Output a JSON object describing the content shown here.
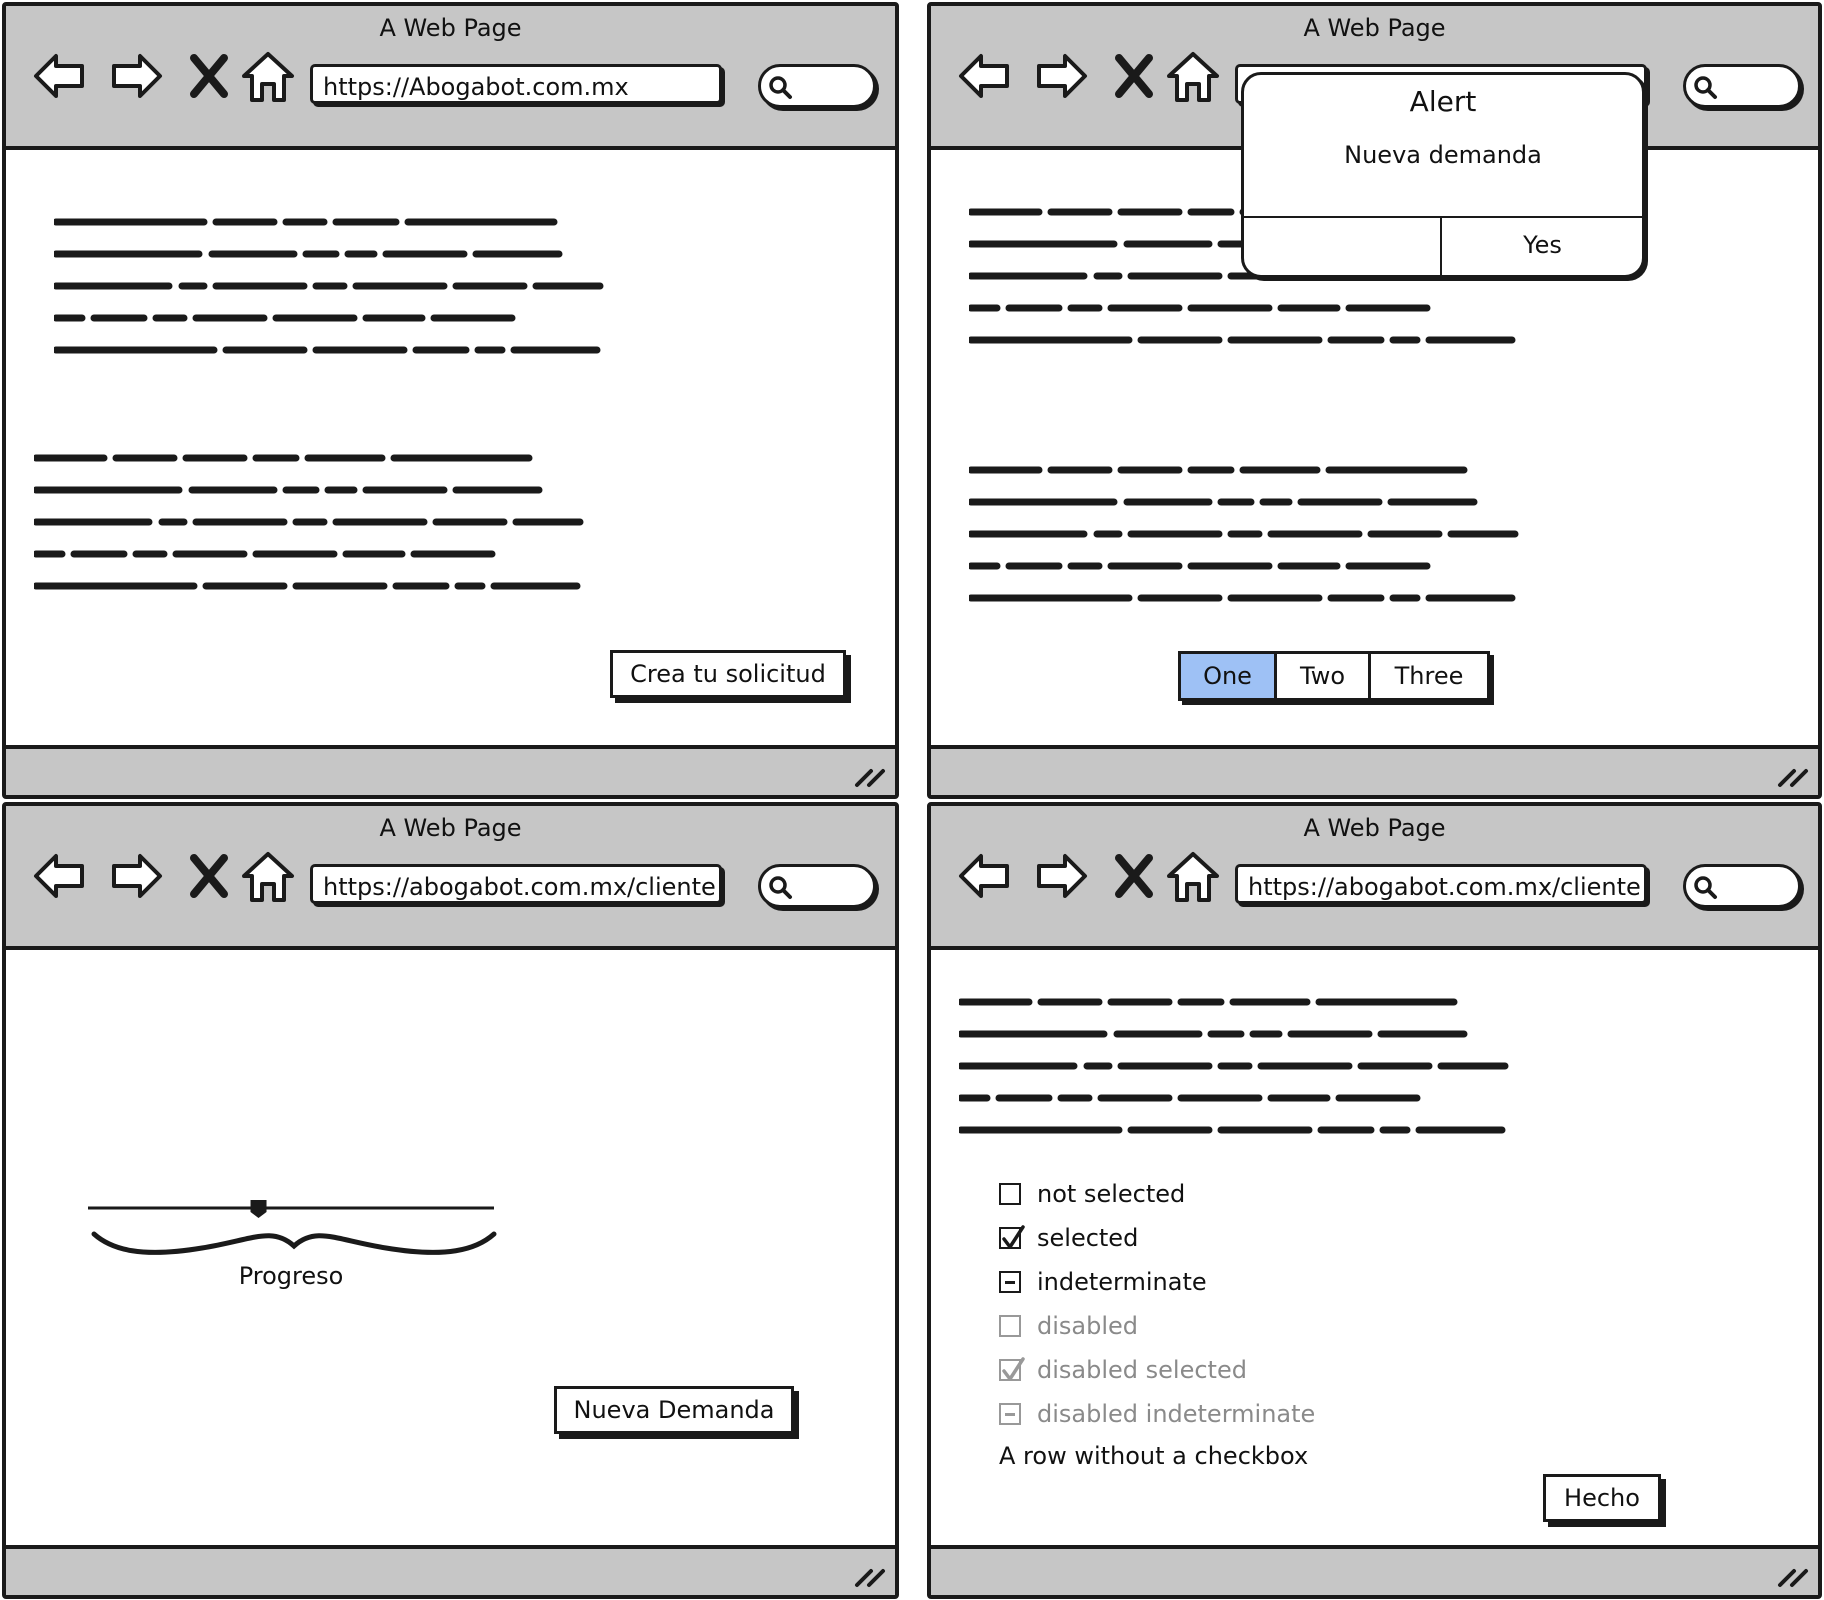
{
  "windows": [
    {
      "title": "A Web Page",
      "url": "https://Abogabot.com.mx",
      "button_label": "Crea tu solicitud"
    },
    {
      "title": "A Web Page",
      "alert": {
        "title": "Alert",
        "message": "Nueva demanda",
        "button_label": "Yes"
      },
      "segmented": [
        "One",
        "Two",
        "Three"
      ],
      "segmented_selected": "One"
    },
    {
      "title": "A Web Page",
      "url": "https://abogabot.com.mx/cliente",
      "progress_label": "Progreso",
      "progress_value": 0.42,
      "button_label": "Nueva Demanda"
    },
    {
      "title": "A Web Page",
      "url": "https://abogabot.com.mx/cliente",
      "checkboxes": [
        {
          "label": "not selected",
          "state": "unchecked",
          "disabled": false
        },
        {
          "label": "selected",
          "state": "checked",
          "disabled": false
        },
        {
          "label": "indeterminate",
          "state": "indeterminate",
          "disabled": false
        },
        {
          "label": "disabled",
          "state": "unchecked",
          "disabled": true
        },
        {
          "label": "disabled selected",
          "state": "checked",
          "disabled": true
        },
        {
          "label": "disabled indeterminate",
          "state": "indeterminate",
          "disabled": true
        }
      ],
      "plain_row": "A row without a checkbox",
      "button_label": "Hecho"
    }
  ],
  "icons": [
    "back-arrow-icon",
    "forward-arrow-icon",
    "stop-x-icon",
    "home-icon",
    "search-icon",
    "resize-grip-icon"
  ],
  "colors": {
    "chrome": "#c6c6c6",
    "selected_segment": "#9ec1f5",
    "ink": "#1a1a1a",
    "disabled_text": "#8a8a8a"
  }
}
